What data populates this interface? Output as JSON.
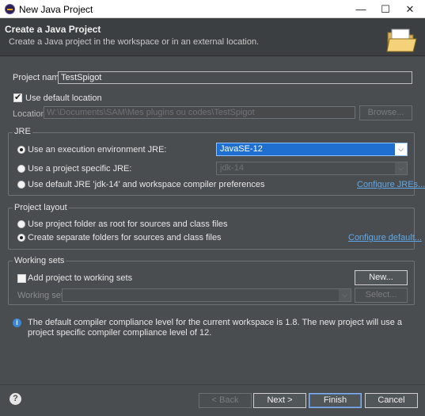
{
  "window": {
    "title": "New Java Project",
    "minimize_icon": "minimize-icon",
    "maximize_icon": "maximize-icon",
    "close_icon": "close-icon"
  },
  "header": {
    "title": "Create a Java Project",
    "description": "Create a Java project in the workspace or in an external location.",
    "icon": "open-folder-icon"
  },
  "project": {
    "name_label": "Project name:",
    "name_value": "TestSpigot"
  },
  "location": {
    "use_default_label": "Use default location",
    "use_default_checked": true,
    "location_label": "Location:",
    "location_value": "W:\\Documents\\SAM\\Mes plugins ou codes\\TestSpigot",
    "browse_label": "Browse..."
  },
  "jre": {
    "group_label": "JRE",
    "options": [
      {
        "label": "Use an execution environment JRE:",
        "selected": true
      },
      {
        "label": "Use a project specific JRE:",
        "selected": false
      },
      {
        "label": "Use default JRE 'jdk-14' and workspace compiler preferences",
        "selected": false
      }
    ],
    "execution_env_value": "JavaSE-12",
    "project_specific_value": "jdk-14",
    "configure_link": "Configure JREs..."
  },
  "layout": {
    "group_label": "Project layout",
    "options": [
      {
        "label": "Use project folder as root for sources and class files",
        "selected": false
      },
      {
        "label": "Create separate folders for sources and class files",
        "selected": true
      }
    ],
    "configure_link": "Configure default..."
  },
  "working_sets": {
    "group_label": "Working sets",
    "add_label": "Add project to working sets",
    "add_checked": false,
    "new_label": "New...",
    "sets_label": "Working sets:",
    "select_label": "Select..."
  },
  "info": {
    "message": "The default compiler compliance level for the current workspace is 1.8. The new project will use a project specific compiler compliance level of 12."
  },
  "footer": {
    "help_icon": "help-icon",
    "back_label": "< Back",
    "next_label": "Next >",
    "finish_label": "Finish",
    "cancel_label": "Cancel"
  }
}
